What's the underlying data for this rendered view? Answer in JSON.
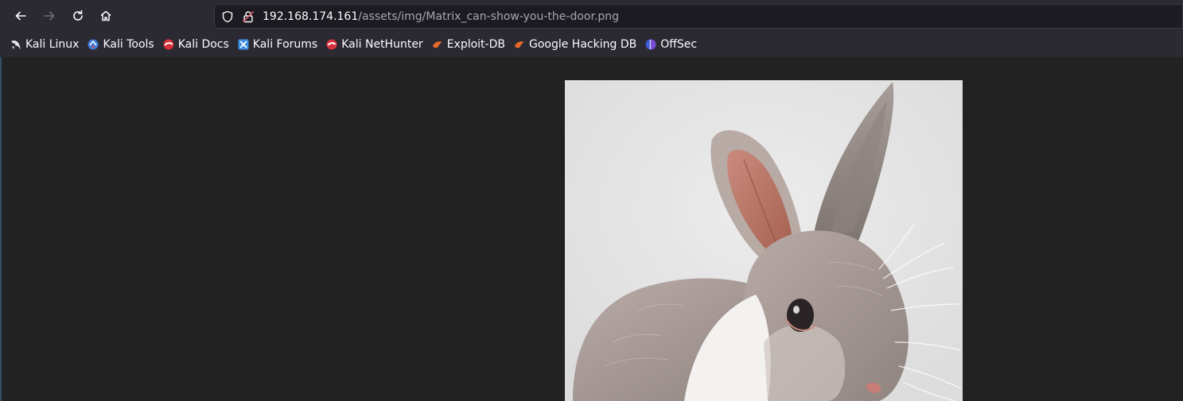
{
  "browser": {
    "url": {
      "host": "192.168.174.161",
      "path": "/assets/img/Matrix_can-show-you-the-door.png"
    },
    "bookmarks": [
      {
        "label": "Kali Linux",
        "icon": "kali-dragon-icon"
      },
      {
        "label": "Kali Tools",
        "icon": "kali-tools-icon"
      },
      {
        "label": "Kali Docs",
        "icon": "kali-docs-icon"
      },
      {
        "label": "Kali Forums",
        "icon": "kali-forums-icon"
      },
      {
        "label": "Kali NetHunter",
        "icon": "kali-nethunter-icon"
      },
      {
        "label": "Exploit-DB",
        "icon": "exploit-db-icon"
      },
      {
        "label": "Google Hacking DB",
        "icon": "ghdb-icon"
      },
      {
        "label": "OffSec",
        "icon": "offsec-icon"
      }
    ]
  },
  "content": {
    "image_subject": "rabbit"
  },
  "colors": {
    "toolbar": "#2b2a33",
    "page_background": "#222222",
    "url_field": "#1c1b22",
    "insecure_lock": "#e05a6a"
  }
}
